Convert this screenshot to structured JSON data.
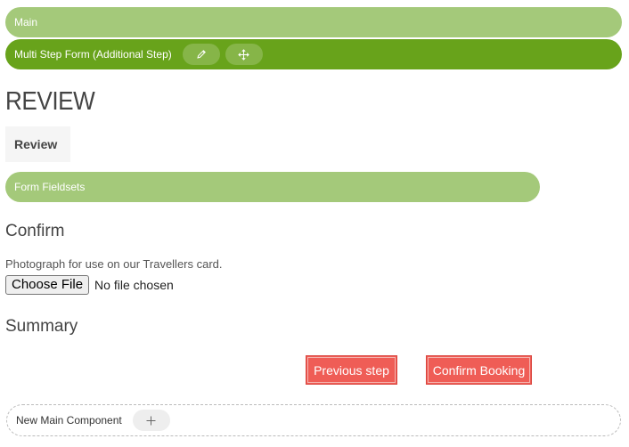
{
  "main_bar": {
    "label": "Main"
  },
  "multistep_bar": {
    "label": "Multi Step Form (Additional Step)"
  },
  "page": {
    "heading": "REVIEW"
  },
  "tab": {
    "label": "Review"
  },
  "fieldsets_bar": {
    "label": "Form Fieldsets"
  },
  "confirm": {
    "heading": "Confirm",
    "photo_label": "Photograph for use on our Travellers card.",
    "file_button": "Choose File",
    "file_status": "No file chosen"
  },
  "summary": {
    "heading": "Summary"
  },
  "actions": {
    "previous": "Previous step",
    "confirm": "Confirm Booking"
  },
  "new_component": {
    "label": "New Main Component"
  },
  "colors": {
    "light_green": "#a4c97a",
    "dark_green": "#68a31b",
    "red_button": "#ef5d56"
  },
  "icons": {
    "edit": "pencil-icon",
    "move": "move-icon",
    "add": "plus-icon"
  }
}
